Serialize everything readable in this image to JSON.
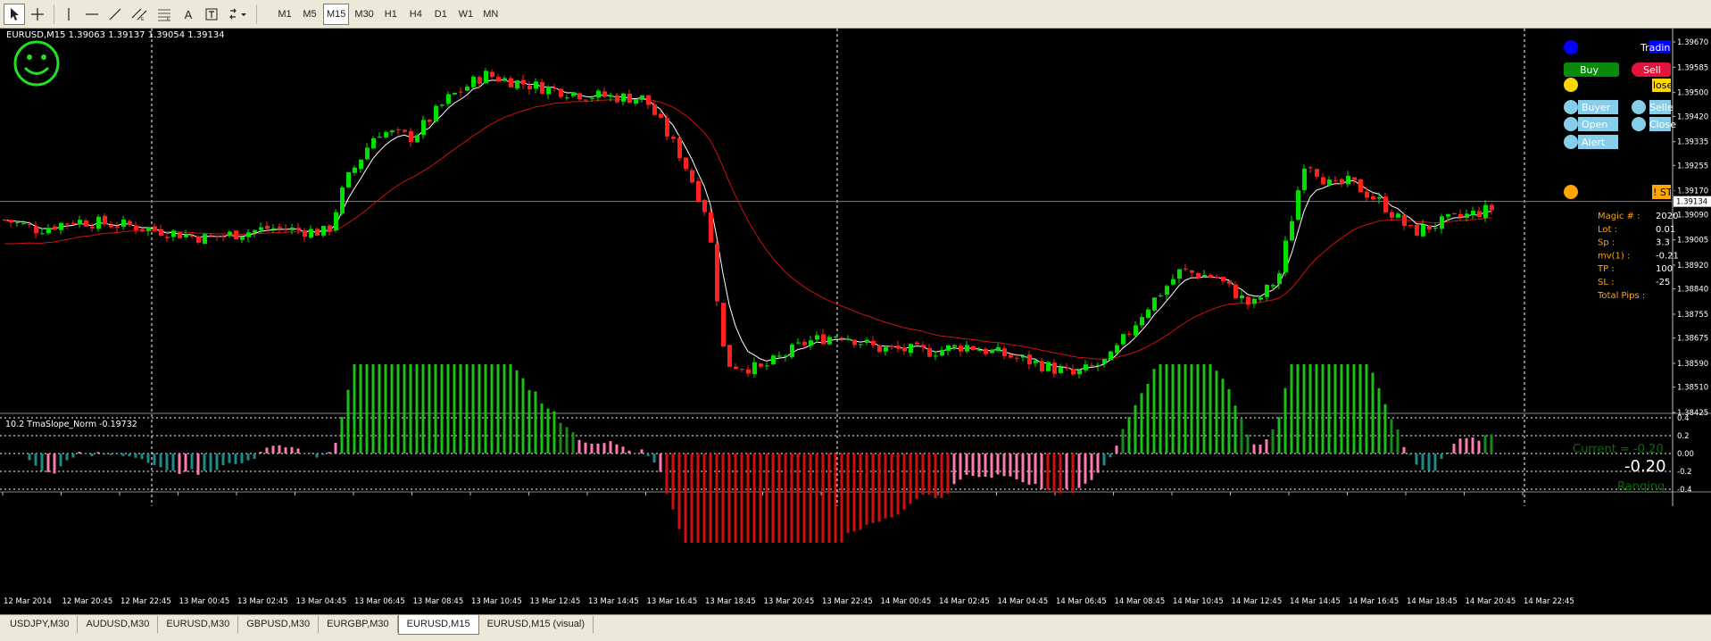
{
  "toolbar": {
    "tools": [
      {
        "name": "cursor-tool-icon"
      },
      {
        "name": "crosshair-tool-icon"
      },
      {
        "name": "vertical-line-tool-icon"
      },
      {
        "name": "horizontal-line-tool-icon"
      },
      {
        "name": "trendline-tool-icon"
      },
      {
        "name": "equidistant-channel-tool-icon"
      },
      {
        "name": "fibonacci-tool-icon"
      },
      {
        "name": "text-tool-icon"
      },
      {
        "name": "text-label-tool-icon"
      },
      {
        "name": "arrows-tool-icon"
      }
    ],
    "text_tool_label": "A",
    "timeframes": [
      "M1",
      "M5",
      "M15",
      "M30",
      "H1",
      "H4",
      "D1",
      "W1",
      "MN"
    ],
    "active_timeframe": "M15"
  },
  "chart": {
    "header": "EURUSD,M15  1.39063 1.39137 1.39054 1.39134",
    "symbol": "EURUSD",
    "timeframe": "M15",
    "ohlc": {
      "open": 1.39063,
      "high": 1.39137,
      "low": 1.39054,
      "close": 1.39134
    },
    "current_price_label": "1.39134",
    "smiley_icon": "smiley-face-icon",
    "colors": {
      "bull": "#00e000",
      "bear": "#ff2020",
      "fast_ma": "#ffffff",
      "slow_ma": "#d01010",
      "bid_line": "#808080",
      "grid": "#ffffff"
    }
  },
  "price_axis": {
    "ticks": [
      "1.39670",
      "1.39585",
      "1.39500",
      "1.39420",
      "1.39335",
      "1.39255",
      "1.39170",
      "1.39090",
      "1.39005",
      "1.38920",
      "1.38840",
      "1.38755",
      "1.38675",
      "1.38590",
      "1.38510",
      "1.38425"
    ]
  },
  "time_axis": {
    "ticks": [
      "12 Mar 2014",
      "12 Mar 20:45",
      "12 Mar 22:45",
      "13 Mar 00:45",
      "13 Mar 02:45",
      "13 Mar 04:45",
      "13 Mar 06:45",
      "13 Mar 08:45",
      "13 Mar 10:45",
      "13 Mar 12:45",
      "13 Mar 14:45",
      "13 Mar 16:45",
      "13 Mar 18:45",
      "13 Mar 20:45",
      "13 Mar 22:45",
      "14 Mar 00:45",
      "14 Mar 02:45",
      "14 Mar 04:45",
      "14 Mar 06:45",
      "14 Mar 08:45",
      "14 Mar 10:45",
      "14 Mar 12:45",
      "14 Mar 14:45",
      "14 Mar 16:45",
      "14 Mar 18:45",
      "14 Mar 20:45",
      "14 Mar 22:45"
    ]
  },
  "indicator": {
    "label": "10.2 TmaSlope_Norm -0.19732",
    "levels": [
      "0.4",
      "0.2",
      "0.00",
      "-0.2",
      "-0.4"
    ],
    "current_label": "Current = -0.20",
    "value_label": "-0.20",
    "state_label": "Ranging",
    "colors": {
      "strong_up": "#18c018",
      "up": "#1a8a1a",
      "weak_up": "#2a7a2a",
      "ranging_pos": "#ff7ab0",
      "ranging_neg": "#1f8a8a",
      "strong_down": "#d01010"
    }
  },
  "panel": {
    "top_label": "Tradin",
    "buy_label": "Buy",
    "sell_label": "Sell",
    "close_label": "lose",
    "buyer_label": "Buyer",
    "seller_label": "Selle",
    "open_label": "Open",
    "close2_label": "Close",
    "alert_label": "Alert",
    "stop_label": "! STO",
    "colors": {
      "blue_dot": "#0000ff",
      "green_dot": "#0a8a0a",
      "red_dot": "#e0143c",
      "yellow_dot": "#ffd700",
      "light_blue": "#87ceeb",
      "orange_dot": "#ffa500"
    }
  },
  "info": {
    "rows": [
      {
        "label": "Magic # :",
        "value": "2020"
      },
      {
        "label": "Lot :",
        "value": "0.01"
      },
      {
        "label": "Sp :",
        "value": "3.3"
      },
      {
        "label": "mv(1) :",
        "value": "-0.21"
      },
      {
        "label": "TP :",
        "value": "100"
      },
      {
        "label": "SL :",
        "value": "-25"
      },
      {
        "label": "Total Pips :",
        "value": ""
      }
    ]
  },
  "tabs": [
    "USDJPY,M30",
    "AUDUSD,M30",
    "EURUSD,M30",
    "GBPUSD,M30",
    "EURGBP,M30",
    "EURUSD,M15",
    "EURUSD,M15 (visual)"
  ],
  "active_tab": "EURUSD,M15"
}
